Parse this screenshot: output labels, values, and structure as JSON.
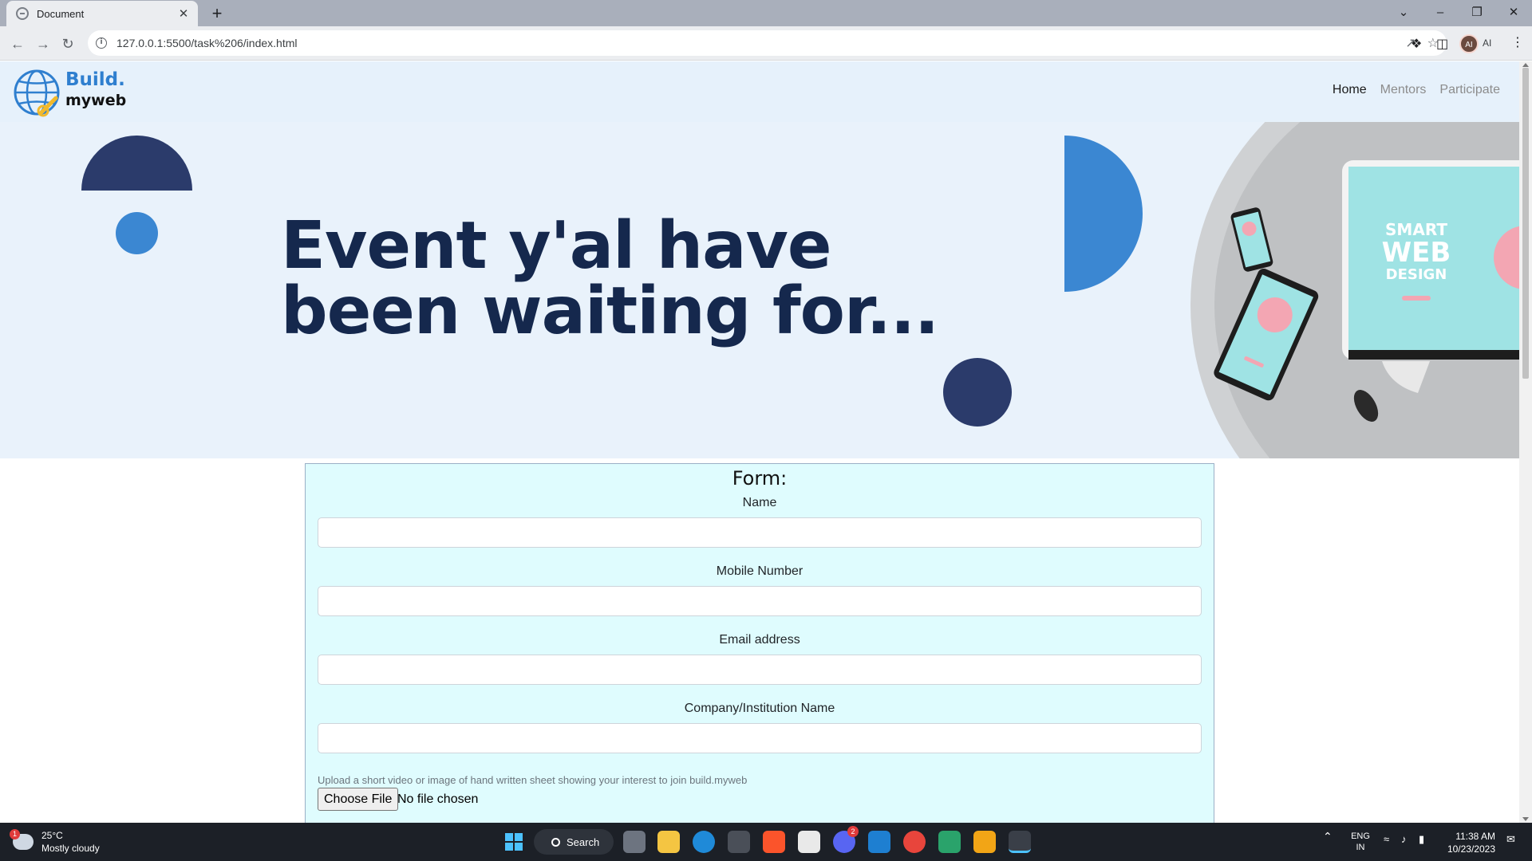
{
  "browser": {
    "tab_title": "Document",
    "tab_close": "✕",
    "new_tab": "+",
    "url": "127.0.0.1:5500/task%206/index.html",
    "profile_initials": "AI",
    "profile_label": "AI",
    "window_controls": {
      "tab_search": "⌄",
      "minimize": "–",
      "restore": "❐",
      "close": "✕"
    }
  },
  "site": {
    "logo": {
      "line1": "Build.",
      "line2": "myweb"
    },
    "nav": [
      {
        "label": "Home",
        "active": true
      },
      {
        "label": "Mentors",
        "active": false
      },
      {
        "label": "Participate",
        "active": false
      }
    ],
    "hero": {
      "headline_line1": "Event y'al have",
      "headline_line2": "been waiting for...",
      "image_text_1": "SMART",
      "image_text_2": "WEB",
      "image_text_3": "DESIGN"
    },
    "form": {
      "title": "Form:",
      "fields": [
        {
          "label": "Name",
          "value": ""
        },
        {
          "label": "Mobile Number",
          "value": ""
        },
        {
          "label": "Email address",
          "value": ""
        },
        {
          "label": "Company/Institution Name",
          "value": ""
        }
      ],
      "upload_note": "Upload a short video or image of hand written sheet showing your interest to join build.myweb",
      "file_button": "Choose File",
      "file_status": "No file chosen"
    }
  },
  "taskbar": {
    "weather_temp": "25°C",
    "weather_desc": "Mostly cloudy",
    "weather_badge": "1",
    "search_label": "Search",
    "discord_badge": "2",
    "lang_line1": "ENG",
    "lang_line2": "IN",
    "time": "11:38 AM",
    "date": "10/23/2023"
  },
  "colors": {
    "nav_bg": "#e6f1fb",
    "hero_bg": "#e9f2fb",
    "navy": "#2b3b6b",
    "accent_blue": "#3b87d2",
    "headline": "#15284d",
    "form_bg": "#dffcfe"
  }
}
